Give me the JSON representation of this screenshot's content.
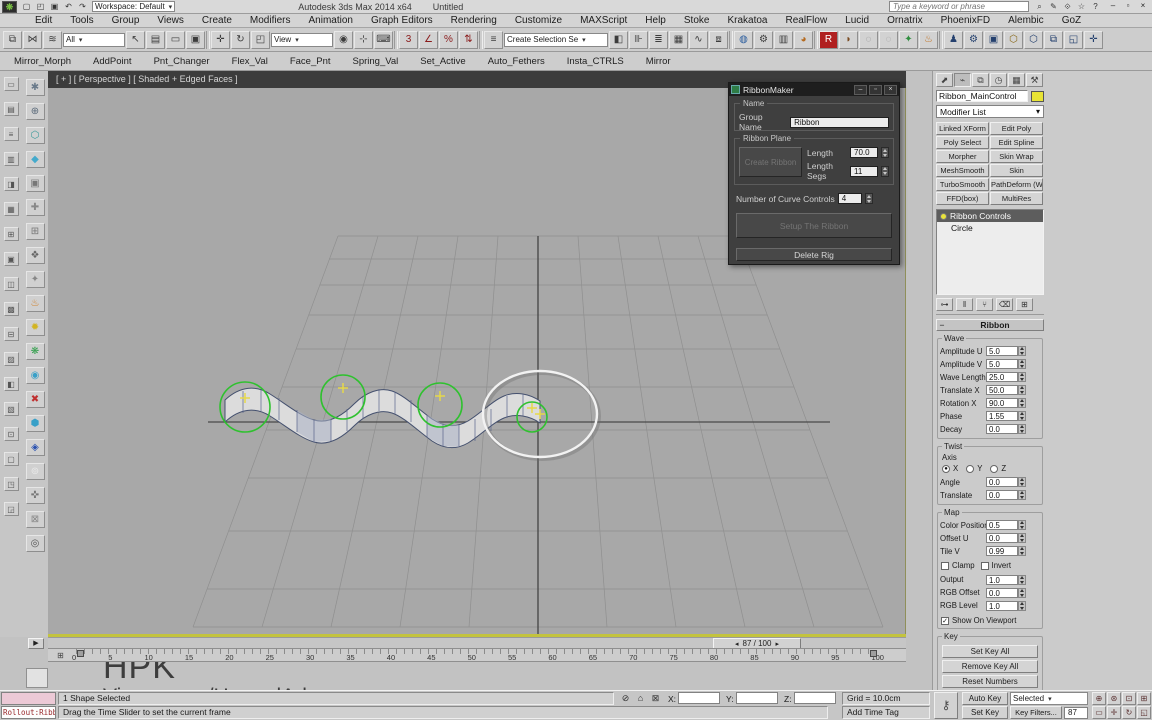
{
  "window": {
    "logo_glyph": "❋",
    "title": "Autodesk 3ds Max 2014 x64",
    "doc": "Untitled",
    "search_placeholder": "Type a keyword or phrase",
    "qat_icons": [
      {
        "name": "new-scene-icon",
        "glyph": "▢"
      },
      {
        "name": "open-file-icon",
        "glyph": "◰"
      },
      {
        "name": "save-file-icon",
        "glyph": "▣"
      },
      {
        "name": "undo-icon",
        "glyph": "↶"
      },
      {
        "name": "redo-icon",
        "glyph": "↷"
      }
    ],
    "workspace_value": "Workspace: Default",
    "search_icons": [
      {
        "name": "search-icon",
        "glyph": "⌕"
      },
      {
        "name": "communication-icon",
        "glyph": "✎"
      },
      {
        "name": "sign-in-icon",
        "glyph": "⟐"
      },
      {
        "name": "favorites-icon",
        "glyph": "☆"
      },
      {
        "name": "help-icon",
        "glyph": "?"
      }
    ],
    "controls": [
      {
        "name": "minimize-button",
        "glyph": "–"
      },
      {
        "name": "restore-button",
        "glyph": "▫"
      },
      {
        "name": "close-button",
        "glyph": "×"
      }
    ]
  },
  "menus": [
    "Edit",
    "Tools",
    "Group",
    "Views",
    "Create",
    "Modifiers",
    "Animation",
    "Graph Editors",
    "Rendering",
    "Customize",
    "MAXScript",
    "Help",
    "Stoke",
    "Krakatoa",
    "RealFlow",
    "Lucid",
    "Ornatrix",
    "PhoenixFD",
    "Alembic",
    "GoZ"
  ],
  "main_toolbar": {
    "filter_value": "All",
    "coord_value": "View",
    "selset_value": "Create Selection Se",
    "icons_a": [
      {
        "name": "select-and-link-icon",
        "glyph": "⧉"
      },
      {
        "name": "unlink-selection-icon",
        "glyph": "⋈"
      },
      {
        "name": "bind-to-space-warp-icon",
        "glyph": "≋"
      }
    ],
    "icons_b": [
      {
        "name": "select-object-icon",
        "glyph": "↖"
      },
      {
        "name": "select-by-name-icon",
        "glyph": "▤"
      },
      {
        "name": "rect-selection-region-icon",
        "glyph": "▭"
      },
      {
        "name": "window-crossing-icon",
        "glyph": "▣"
      },
      {
        "sep": true
      },
      {
        "name": "select-and-move-icon",
        "glyph": "✛"
      },
      {
        "name": "select-and-rotate-icon",
        "glyph": "↻"
      },
      {
        "name": "select-and-scale-icon",
        "glyph": "◰"
      }
    ],
    "icons_c": [
      {
        "name": "use-pivot-center-icon",
        "glyph": "◉"
      },
      {
        "name": "select-and-manipulate-icon",
        "glyph": "⊹"
      },
      {
        "name": "keyboard-override-icon",
        "glyph": "⌨"
      },
      {
        "sep": true
      },
      {
        "name": "snaps-toggle-icon",
        "glyph": "3",
        "color": "#8a1a1a"
      },
      {
        "name": "angle-snap-icon",
        "glyph": "∠",
        "color": "#8a1a1a"
      },
      {
        "name": "percent-snap-icon",
        "glyph": "%",
        "color": "#8a1a1a"
      },
      {
        "name": "spinner-snap-icon",
        "glyph": "⇅",
        "color": "#8a1a1a"
      },
      {
        "sep": true
      },
      {
        "name": "named-selection-sets-icon",
        "glyph": "≡"
      }
    ],
    "icons_d": [
      {
        "name": "mirror-icon",
        "glyph": "◧"
      },
      {
        "name": "align-icon",
        "glyph": "⊪"
      },
      {
        "name": "layer-manager-icon",
        "glyph": "≣"
      },
      {
        "name": "graphite-ribbon-icon",
        "glyph": "▦"
      },
      {
        "name": "curve-editor-icon",
        "glyph": "∿"
      },
      {
        "name": "schematic-view-icon",
        "glyph": "⧈"
      },
      {
        "sep": true
      },
      {
        "name": "material-editor-icon",
        "glyph": "◍",
        "color": "#2a5c9e"
      },
      {
        "name": "render-setup-icon",
        "glyph": "⚙"
      },
      {
        "name": "rendered-frame-icon",
        "glyph": "▥"
      },
      {
        "name": "render-production-icon",
        "glyph": "◕",
        "color": "#b56a1e"
      },
      {
        "sep": true
      },
      {
        "name": "railclone-plugin-icon",
        "glyph": "R",
        "color": "#fff",
        "bg": "#b02020"
      },
      {
        "name": "forestpack-plugin-icon",
        "glyph": "◗",
        "color": "#7a4a20"
      },
      {
        "name": "plugin-icon",
        "glyph": "◌",
        "color": "#8a8a8a"
      },
      {
        "name": "plugin-icon",
        "glyph": "◌",
        "color": "#9a9a9a"
      },
      {
        "name": "speedtree-plugin-icon",
        "glyph": "✦",
        "color": "#2e8e3e"
      },
      {
        "name": "phoenix-plugin-icon",
        "glyph": "♨",
        "color": "#c2701e"
      },
      {
        "sep": true
      },
      {
        "name": "character-tool-icon",
        "glyph": "♟",
        "color": "#24406e"
      },
      {
        "name": "character-tool-icon",
        "glyph": "⚙",
        "color": "#24406e"
      },
      {
        "name": "character-tool-icon",
        "glyph": "▣",
        "color": "#24406e"
      },
      {
        "name": "bone-tool-icon",
        "glyph": "⬡",
        "color": "#8a6a1a"
      },
      {
        "name": "bone-tool-icon",
        "glyph": "⬡",
        "color": "#24406e"
      },
      {
        "name": "rig-tool-icon",
        "glyph": "⧉",
        "color": "#24406e"
      },
      {
        "name": "rig-tool-icon",
        "glyph": "◱",
        "color": "#24406e"
      },
      {
        "name": "rig-tool-icon",
        "glyph": "✛",
        "color": "#24406e"
      }
    ]
  },
  "script_toolbar": [
    "Mirror_Morph",
    "AddPoint",
    "Pnt_Changer",
    "Flex_Val",
    "Face_Pnt",
    "Spring_Val",
    "Set_Active",
    "Auto_Fethers",
    "Insta_CTRLS",
    "Mirror"
  ],
  "left_dock": {
    "narrow_icons": [
      {
        "name": "dock-tool-icon",
        "glyph": "▭"
      },
      {
        "name": "dock-tool-icon",
        "glyph": "▤"
      },
      {
        "name": "dock-tool-icon",
        "glyph": "≡"
      },
      {
        "name": "dock-tool-icon",
        "glyph": "▥"
      },
      {
        "name": "dock-tool-icon",
        "glyph": "◨"
      },
      {
        "name": "dock-tool-icon",
        "glyph": "▦"
      },
      {
        "name": "dock-tool-icon",
        "glyph": "⊞"
      },
      {
        "name": "dock-tool-icon",
        "glyph": "▣"
      },
      {
        "name": "dock-tool-icon",
        "glyph": "◫"
      },
      {
        "name": "dock-tool-icon",
        "glyph": "▩"
      },
      {
        "name": "dock-tool-icon",
        "glyph": "⊟"
      },
      {
        "name": "dock-tool-icon",
        "glyph": "▨"
      },
      {
        "name": "dock-tool-icon",
        "glyph": "◧"
      },
      {
        "name": "dock-tool-icon",
        "glyph": "▧"
      },
      {
        "name": "dock-tool-icon",
        "glyph": "⊡"
      },
      {
        "name": "dock-tool-icon",
        "glyph": "▢"
      },
      {
        "name": "dock-tool-icon",
        "glyph": "◳"
      },
      {
        "name": "dock-tool-icon",
        "glyph": "◲"
      }
    ],
    "color_icons": [
      {
        "name": "rig-script-icon",
        "glyph": "✱",
        "color": "#6a7a8a"
      },
      {
        "name": "rig-script-icon",
        "glyph": "⊕",
        "color": "#5a6a7a"
      },
      {
        "name": "rig-script-icon",
        "glyph": "⬡",
        "color": "#3a9a9a"
      },
      {
        "name": "rig-script-icon",
        "glyph": "◆",
        "color": "#44aacc"
      },
      {
        "name": "rig-script-icon",
        "glyph": "▣",
        "color": "#777"
      },
      {
        "name": "rig-script-icon",
        "glyph": "✚",
        "color": "#888"
      },
      {
        "name": "rig-script-icon",
        "glyph": "⊞",
        "color": "#777"
      },
      {
        "name": "rig-script-icon",
        "glyph": "❖",
        "color": "#666"
      },
      {
        "name": "rig-script-icon",
        "glyph": "✦",
        "color": "#888"
      },
      {
        "name": "rig-script-icon",
        "glyph": "♨",
        "color": "#d07818"
      },
      {
        "name": "rig-script-icon",
        "glyph": "✹",
        "color": "#d2b420"
      },
      {
        "name": "rig-script-icon",
        "glyph": "❋",
        "color": "#2e9e48"
      },
      {
        "name": "rig-script-icon",
        "glyph": "◉",
        "color": "#38a0c8"
      },
      {
        "name": "rig-script-icon",
        "glyph": "✖",
        "color": "#c03030"
      },
      {
        "name": "rig-script-icon",
        "glyph": "⬢",
        "color": "#38a0c8"
      },
      {
        "name": "rig-script-icon",
        "glyph": "◈",
        "color": "#2850b0"
      },
      {
        "name": "rig-script-icon",
        "glyph": "⊚",
        "color": "#e8e8e8"
      },
      {
        "name": "rig-script-icon",
        "glyph": "✜",
        "color": "#777"
      },
      {
        "name": "rig-script-icon",
        "glyph": "⊠",
        "color": "#888"
      },
      {
        "name": "rig-script-icon",
        "glyph": "◎",
        "color": "#555"
      }
    ]
  },
  "viewport": {
    "label": "[ + ] [ Perspective ] [ Shaded + Edged Faces ]",
    "watermark_line1": "HPK",
    "watermark_line2": "Vimeo.com/HamedAdv",
    "colors": {
      "background": "#a8a8a8",
      "grid_line": "#8f8f8f",
      "axis_line": "#3c3c3c",
      "control_circle": "#2fc12f",
      "selection_circle": "#f2f2f2",
      "point_marker": "#e6d84a"
    }
  },
  "ribbonmaker": {
    "title": "RibbonMaker",
    "name_group_label": "Name",
    "group_name_label": "Group Name",
    "group_name_value": "Ribbon",
    "plane_group_label": "Ribbon Plane",
    "create_button": "Create Ribbon",
    "length_label": "Length",
    "length_value": "70.0",
    "segs_label": "Length Segs",
    "segs_value": "11",
    "curve_controls_label": "Number of Curve Controls",
    "curve_controls_value": "4",
    "setup_button": "Setup The Ribbon",
    "delete_button": "Delete Rig",
    "controls": [
      {
        "name": "dialog-minimize-button",
        "glyph": "–"
      },
      {
        "name": "dialog-restore-button",
        "glyph": "▫"
      },
      {
        "name": "dialog-close-button",
        "glyph": "×"
      }
    ]
  },
  "command_panel": {
    "tabs": [
      {
        "name": "tab-create",
        "glyph": "⬈"
      },
      {
        "name": "tab-modify",
        "glyph": "⌁",
        "selected": true
      },
      {
        "name": "tab-hierarchy",
        "glyph": "⧉"
      },
      {
        "name": "tab-motion",
        "glyph": "◷"
      },
      {
        "name": "tab-display",
        "glyph": "▦"
      },
      {
        "name": "tab-utilities",
        "glyph": "⚒"
      }
    ],
    "object_name": "Ribbon_MainControl",
    "object_color": "#e8e435",
    "modifier_list_label": "Modifier List",
    "modifier_buttons": [
      "Linked XForm",
      "Edit Poly",
      "Poly Select",
      "Edit Spline",
      "Morpher",
      "Skin Wrap",
      "MeshSmooth",
      "Skin",
      "TurboSmooth",
      "PathDeform (WS",
      "FFD(box)",
      "MultiRes"
    ],
    "stack": [
      {
        "label": "Ribbon Controls",
        "selected": true
      },
      {
        "label": "Circle",
        "selected": false
      }
    ],
    "stack_tools": [
      {
        "name": "pin-stack-icon",
        "glyph": "⊶"
      },
      {
        "name": "show-end-result-icon",
        "glyph": "‖"
      },
      {
        "name": "make-unique-icon",
        "glyph": "⑂"
      },
      {
        "name": "remove-modifier-icon",
        "glyph": "⌫"
      },
      {
        "name": "configure-modifier-sets-icon",
        "glyph": "⊞"
      }
    ],
    "rollout_title": "Ribbon",
    "wave": {
      "title": "Wave",
      "fields": [
        {
          "label": "Amplitude U",
          "value": "5.0"
        },
        {
          "label": "Amplitude V",
          "value": "5.0"
        },
        {
          "label": "Wave Length",
          "value": "25.0"
        },
        {
          "label": "Translate X",
          "value": "50.0"
        },
        {
          "label": "Rotation X",
          "value": "90.0"
        },
        {
          "label": "Phase",
          "value": "1.55"
        },
        {
          "label": "Decay",
          "value": "0.0"
        }
      ]
    },
    "twist": {
      "title": "Twist",
      "axis_label": "Axis",
      "axis_options": [
        {
          "label": "X",
          "selected": true
        },
        {
          "label": "Y",
          "selected": false
        },
        {
          "label": "Z",
          "selected": false
        }
      ],
      "fields": [
        {
          "label": "Angle",
          "value": "0.0"
        },
        {
          "label": "Translate",
          "value": "0.0"
        }
      ]
    },
    "map": {
      "title": "Map",
      "fields1": [
        {
          "label": "Color Position",
          "value": "0.5"
        },
        {
          "label": "Offset U",
          "value": "0.0"
        },
        {
          "label": "Tile V",
          "value": "0.99"
        }
      ],
      "checks": [
        {
          "label": "Clamp",
          "checked": false
        },
        {
          "label": "Invert",
          "checked": false
        }
      ],
      "fields2": [
        {
          "label": "Output",
          "value": "1.0"
        },
        {
          "label": "RGB Offset",
          "value": "0.0"
        },
        {
          "label": "RGB Level",
          "value": "1.0"
        }
      ],
      "viewport_check": [
        {
          "label": "Show On Viewport",
          "checked": true
        }
      ]
    },
    "key": {
      "title": "Key",
      "buttons": [
        "Set Key All",
        "Remove Key All",
        "Reset Numbers"
      ]
    }
  },
  "timeline": {
    "slider_label": "87 / 100",
    "ticks": [
      "0",
      "5",
      "10",
      "15",
      "20",
      "25",
      "30",
      "35",
      "40",
      "45",
      "50",
      "55",
      "60",
      "65",
      "70",
      "75",
      "80",
      "85",
      "90",
      "95",
      "100"
    ]
  },
  "status_bar": {
    "listener_text": "Rollout:Ribb",
    "status_line": "1 Shape Selected",
    "prompt_line": "Drag the Time Slider to set the current frame",
    "coord_icons": [
      {
        "name": "selection-lock-icon",
        "glyph": "⊘"
      },
      {
        "name": "absolute-mode-icon",
        "glyph": "⌂"
      },
      {
        "name": "offset-mode-icon",
        "glyph": "⊠"
      }
    ],
    "coord_labels": [
      "X:",
      "Y:",
      "Z:"
    ],
    "grid_label": "Grid = 10.0cm",
    "time_tag_label": "Add Time Tag",
    "auto_key_label": "Auto Key",
    "set_key_label": "Set Key",
    "key_mode_value": "Selected",
    "key_filters_label": "Key Filters...",
    "frame_value": "87",
    "key_icon_glyph": "⚷",
    "nav_icons_row1": [
      {
        "name": "zoom-icon",
        "glyph": "⊕"
      },
      {
        "name": "zoom-all-icon",
        "glyph": "⊛"
      },
      {
        "name": "zoom-extents-icon",
        "glyph": "⊡"
      },
      {
        "name": "zoom-extents-all-icon",
        "glyph": "⊞"
      }
    ],
    "nav_icons_row2": [
      {
        "name": "zoom-region-icon",
        "glyph": "▭"
      },
      {
        "name": "pan-icon",
        "glyph": "✛"
      },
      {
        "name": "orbit-icon",
        "glyph": "↻"
      },
      {
        "name": "maximize-viewport-icon",
        "glyph": "◱"
      }
    ]
  }
}
